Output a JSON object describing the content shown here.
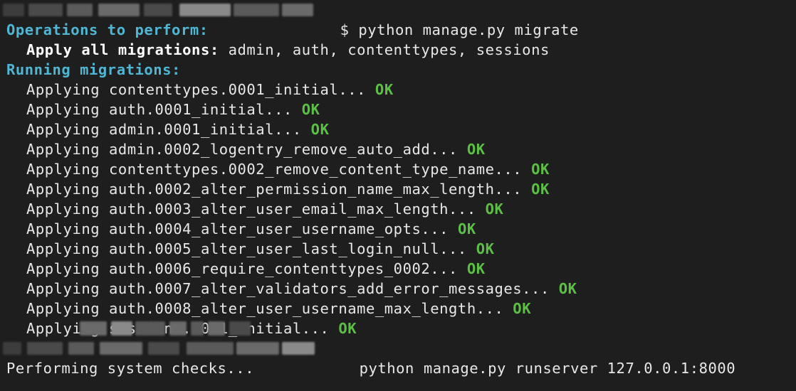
{
  "prompt1": {
    "symbol": "$",
    "command": "python manage.py migrate"
  },
  "ops_header": "Operations to perform:",
  "apply_all": {
    "label": "Apply all migrations:",
    "value": " admin, auth, contenttypes, sessions"
  },
  "running_header": "Running migrations:",
  "migrations": [
    {
      "text": "Applying contenttypes.0001_initial...",
      "status": "OK"
    },
    {
      "text": "Applying auth.0001_initial...",
      "status": "OK"
    },
    {
      "text": "Applying admin.0001_initial...",
      "status": "OK"
    },
    {
      "text": "Applying admin.0002_logentry_remove_auto_add...",
      "status": "OK"
    },
    {
      "text": "Applying contenttypes.0002_remove_content_type_name...",
      "status": "OK"
    },
    {
      "text": "Applying auth.0002_alter_permission_name_max_length...",
      "status": "OK"
    },
    {
      "text": "Applying auth.0003_alter_user_email_max_length...",
      "status": "OK"
    },
    {
      "text": "Applying auth.0004_alter_user_username_opts...",
      "status": "OK"
    },
    {
      "text": "Applying auth.0005_alter_user_last_login_null...",
      "status": "OK"
    },
    {
      "text": "Applying auth.0006_require_contenttypes_0002...",
      "status": "OK"
    },
    {
      "text": "Applying auth.0007_alter_validators_add_error_messages...",
      "status": "OK"
    },
    {
      "text": "Applying auth.0008_alter_user_username_max_length...",
      "status": "OK"
    },
    {
      "text": "Applying sessions.0001_initial...",
      "status": "OK"
    }
  ],
  "prompt2": {
    "command": "python manage.py runserver 127.0.0.1:8000"
  },
  "final_line": "Performing system checks..."
}
